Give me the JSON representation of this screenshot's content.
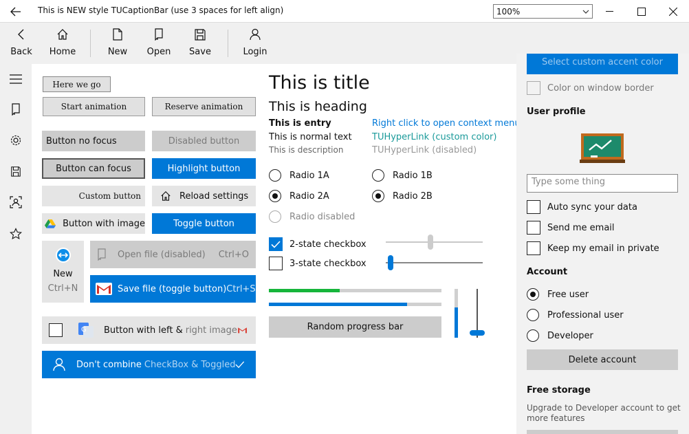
{
  "titlebar": {
    "title": "This is NEW style TUCaptionBar (use 3 spaces for left align)",
    "zoom": "100%"
  },
  "toolbar": {
    "back": "Back",
    "home": "Home",
    "new": "New",
    "open": "Open",
    "save": "Save",
    "login": "Login"
  },
  "leftbar": {
    "icons": [
      "hamburger-icon",
      "document-icon",
      "gear-icon",
      "save-icon",
      "contact-icon",
      "star-icon"
    ]
  },
  "buttons": {
    "here_we_go": "Here we go",
    "start_anim": "Start animation",
    "reserve_anim": "Reserve animation",
    "no_focus": "Button no focus",
    "disabled": "Disabled button",
    "can_focus": "Button can focus",
    "highlight": "Highlight button",
    "custom": "Custom button",
    "reload": "Reload settings",
    "with_image": "Button with image",
    "toggle": "Toggle button",
    "new_label": "New",
    "new_shortcut": "Ctrl+N",
    "open_file": "Open file (disabled)",
    "open_shortcut": "Ctrl+O",
    "save_file": "Save file (toggle button)",
    "save_shortcut": "Ctrl+S",
    "left_right_a": "Button with left & ",
    "left_right_b": "right image",
    "dont_combine_a": "Don't combine ",
    "dont_combine_b": "CheckBox & Toggled"
  },
  "texts": {
    "title": "This is title",
    "heading": "This is heading",
    "entry": "This is entry",
    "normal": "This is normal text",
    "description": "This is description",
    "context_link": "Right click to open context menu",
    "hyperlink_custom": "TUHyperLink (custom color)",
    "hyperlink_disabled": "TUHyperLink (disabled)"
  },
  "radios": {
    "r1a": "Radio 1A",
    "r1b": "Radio 1B",
    "r2a": "Radio 2A",
    "r2b": "Radio 2B",
    "rdis": "Radio disabled"
  },
  "checks": {
    "two_state": "2-state checkbox",
    "three_state": "3-state checkbox"
  },
  "progress": {
    "green": 0.41,
    "blue": 0.8,
    "vbar": 0.62,
    "vslider": 0.95,
    "hslider1": 0.46,
    "hslider2": 0.02,
    "random_button": "Random progress bar"
  },
  "right": {
    "accent_button": "Select custom accent color",
    "color_border": "Color on window border",
    "user_profile": "User profile",
    "input_placeholder": "Type some thing",
    "auto_sync": "Auto sync your data",
    "send_email": "Send me email",
    "keep_private": "Keep my email in private",
    "account": "Account",
    "free_user": "Free user",
    "pro_user": "Professional user",
    "developer": "Developer",
    "delete_account": "Delete account",
    "free_storage": "Free storage",
    "upgrade_text_1": "Upgrade to Developer account to get",
    "upgrade_text_2": "more features"
  },
  "colors": {
    "accent": "#0078d7",
    "green": "#16b53b",
    "gmail_red": "#d93025"
  }
}
